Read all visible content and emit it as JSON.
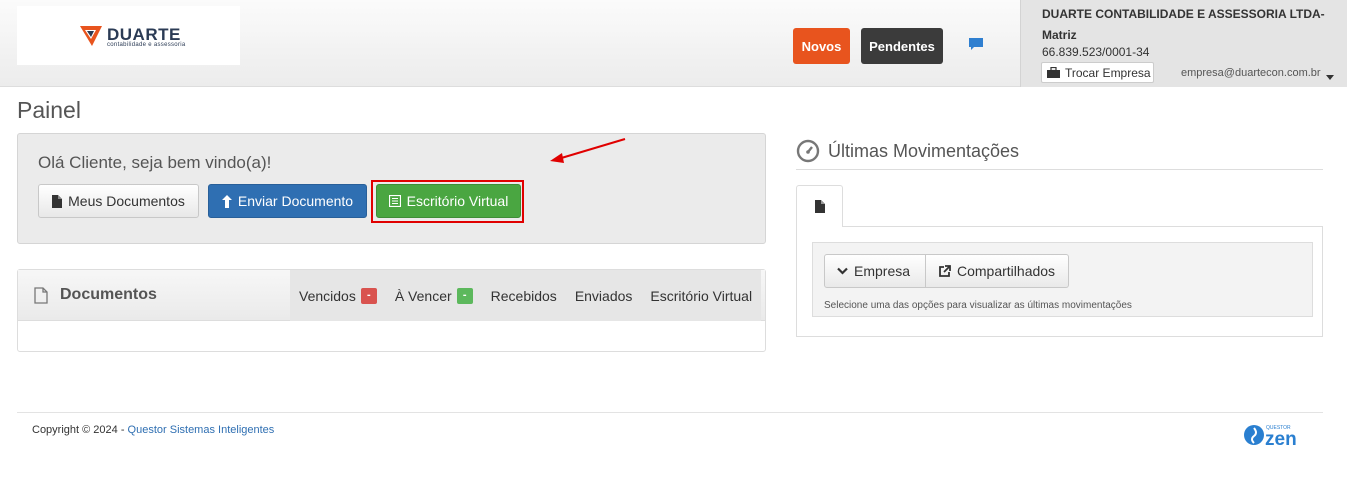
{
  "header": {
    "logo": {
      "name": "DUARTE",
      "tagline": "contabilidade e assessoria"
    },
    "novos_label": "Novos",
    "pendentes_label": "Pendentes",
    "company": {
      "name": "DUARTE CONTABILIDADE E ASSESSORIA LTDA-Matriz",
      "cnpj": "66.839.523/0001-34",
      "switch_label": "Trocar Empresa",
      "email": "empresa@duartecon.com.br"
    }
  },
  "page": {
    "title": "Painel"
  },
  "welcome": {
    "greeting": "Olá Cliente, seja bem vindo(a)!",
    "buttons": {
      "meus_documentos": "Meus Documentos",
      "enviar_documento": "Enviar Documento",
      "escritorio_virtual": "Escritório Virtual"
    }
  },
  "documentos": {
    "title": "Documentos",
    "tabs": [
      {
        "label": "Vencidos",
        "badge": "-"
      },
      {
        "label": "À Vencer",
        "badge": "-"
      },
      {
        "label": "Recebidos"
      },
      {
        "label": "Enviados"
      },
      {
        "label": "Escritório Virtual"
      }
    ]
  },
  "movimentacoes": {
    "title": "Últimas Movimentações",
    "empresa_label": "Empresa",
    "compartilhados_label": "Compartilhados",
    "hint": "Selecione uma das opções para visualizar as últimas movimentações"
  },
  "footer": {
    "copyright": "Copyright © 2024 - ",
    "link_text": "Questor Sistemas Inteligentes",
    "brand_small": "QUESTOR",
    "brand": "zen"
  },
  "colors": {
    "novos": "#e8541e",
    "pendentes": "#3b3b3b",
    "primary": "#2f6fb2",
    "success": "#4aa641",
    "highlight": "#e00000"
  }
}
